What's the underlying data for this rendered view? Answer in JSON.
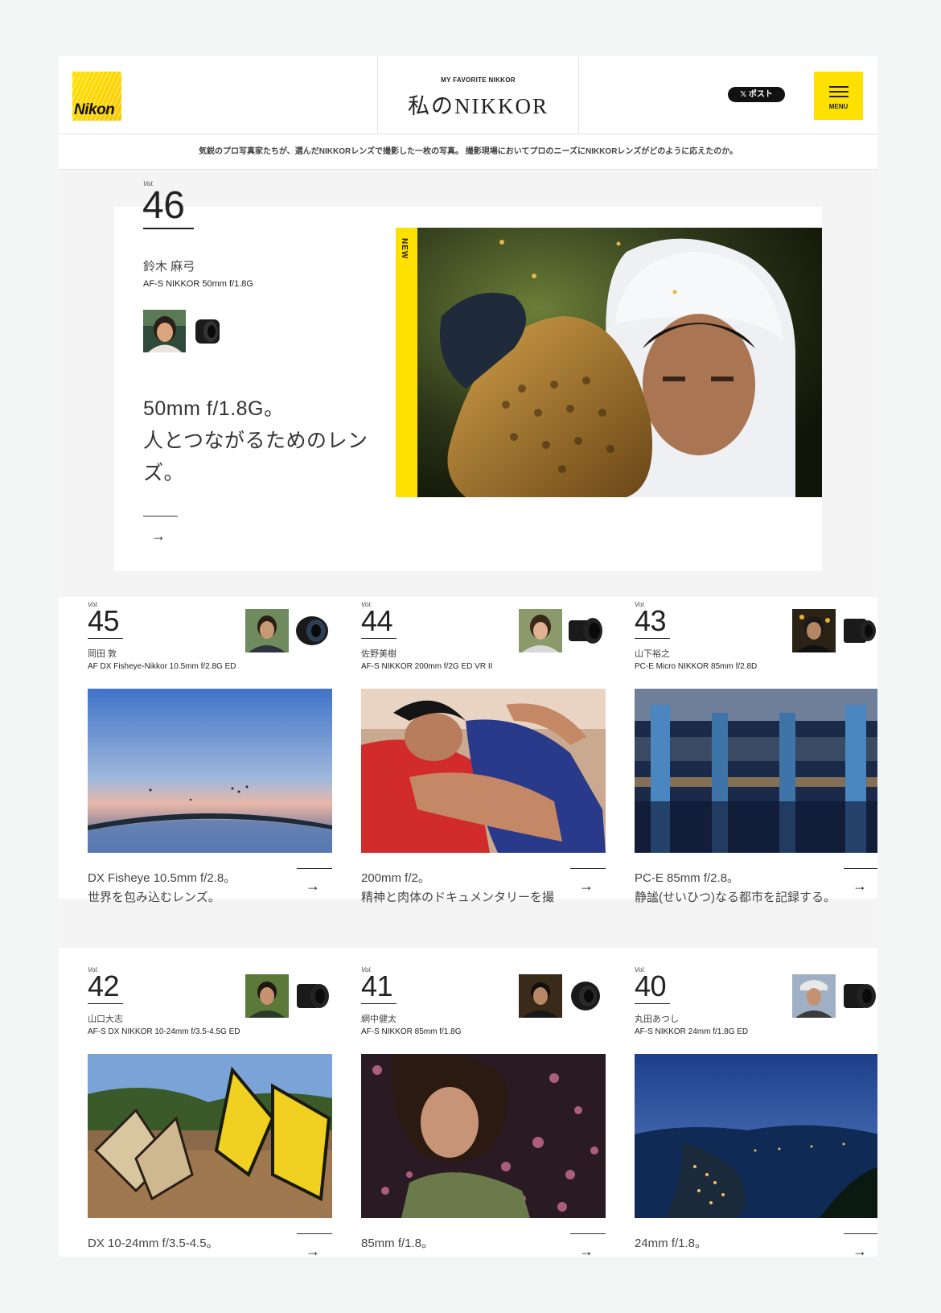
{
  "header": {
    "logo_text": "Nikon",
    "subtitle": "MY FAVORITE NIKKOR",
    "title": "私のNIKKOR",
    "post_button": "𝕏 ポスト",
    "menu_label": "MENU"
  },
  "tagline": "気鋭のプロ写真家たちが、選んだNIKKORレンズで撮影した一枚の写真。 撮影現場においてプロのニーズにNIKKORレンズがどのように応えたのか。",
  "featured": {
    "vol_label": "Vol.",
    "vol": "46",
    "name": "鈴木 麻弓",
    "lens": "AF-S NIKKOR 50mm f/1.8G",
    "headline_1": "50mm f/1.8G。",
    "headline_2": "人とつながるためのレン",
    "headline_3": "ズ。",
    "new_badge": "NEW",
    "arrow": "→"
  },
  "cards": [
    {
      "vol_label": "Vol.",
      "vol": "45",
      "name": "岡田 敦",
      "lens": "AF DX Fisheye-Nikkor 10.5mm f/2.8G ED",
      "headline_1": "DX Fisheye 10.5mm f/2.8。",
      "headline_2": "世界を包み込むレンズ。",
      "arrow": "→"
    },
    {
      "vol_label": "Vol.",
      "vol": "44",
      "name": "佐野美樹",
      "lens": "AF-S NIKKOR 200mm f/2G ED VR II",
      "headline_1": "200mm f/2。",
      "headline_2": "精神と肉体のドキュメンタリーを撮",
      "arrow": "→"
    },
    {
      "vol_label": "Vol.",
      "vol": "43",
      "name": "山下裕之",
      "lens": "PC-E Micro NIKKOR 85mm f/2.8D",
      "headline_1": "PC-E 85mm f/2.8。",
      "headline_2": "静謐(せいひつ)なる都市を記録する。",
      "arrow": "→"
    },
    {
      "vol_label": "Vol.",
      "vol": "42",
      "name": "山口大志",
      "lens": "AF-S DX NIKKOR 10-24mm f/3.5-4.5G ED",
      "headline_1": "DX 10-24mm f/3.5-4.5。",
      "headline_2": "",
      "arrow": "→"
    },
    {
      "vol_label": "Vol.",
      "vol": "41",
      "name": "網中健太",
      "lens": "AF-S NIKKOR 85mm f/1.8G",
      "headline_1": "85mm f/1.8。",
      "headline_2": "",
      "arrow": "→"
    },
    {
      "vol_label": "Vol.",
      "vol": "40",
      "name": "丸田あつし",
      "lens": "AF-S NIKKOR 24mm f/1.8G ED",
      "headline_1": "24mm f/1.8。",
      "headline_2": "",
      "arrow": "→"
    }
  ],
  "colors": {
    "accent_yellow": "#ffe100",
    "text_dark": "#222222",
    "background": "#f4f5f5"
  }
}
